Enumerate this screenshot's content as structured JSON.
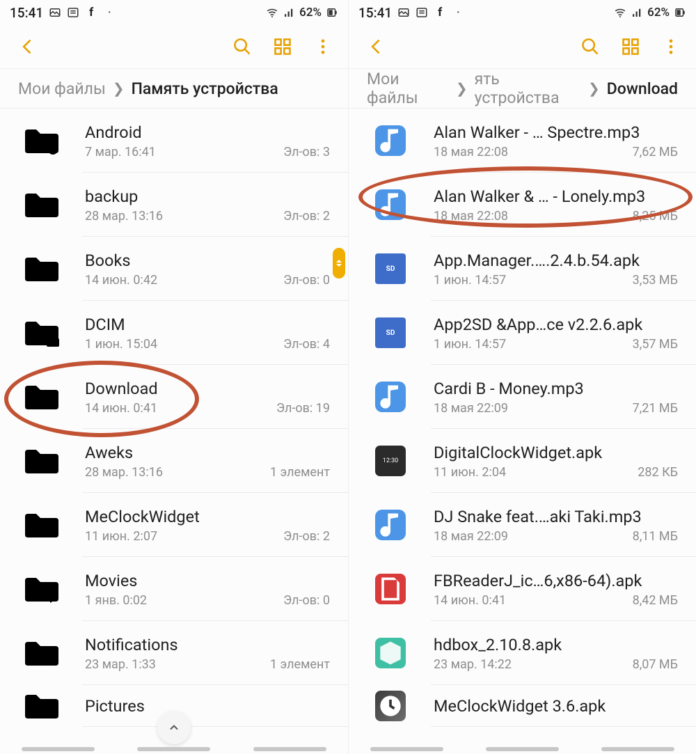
{
  "status": {
    "time": "15:41",
    "battery_pct": "62%"
  },
  "toolbar": {
    "back_label": "back",
    "search_label": "search",
    "grid_label": "grid-view",
    "more_label": "more"
  },
  "left": {
    "breadcrumb": {
      "root": "Мои файлы",
      "current": "Память устройства"
    },
    "rows": [
      {
        "type": "folder-gear",
        "name": "Android",
        "date": "7 мар. 16:41",
        "info": "Эл-ов: 3"
      },
      {
        "type": "folder",
        "name": "backup",
        "date": "28 мар. 13:16",
        "info": "Эл-ов: 2"
      },
      {
        "type": "folder",
        "name": "Books",
        "date": "14 июн. 0:42",
        "info": "Эл-ов: 0"
      },
      {
        "type": "folder-camera",
        "name": "DCIM",
        "date": "1 июн. 15:04",
        "info": "Эл-ов: 4"
      },
      {
        "type": "folder-down",
        "name": "Download",
        "date": "14 июн. 0:41",
        "info": "Эл-ов: 19"
      },
      {
        "type": "folder",
        "name": "Aweks",
        "date": "28 мар. 13:16",
        "info": "1 элемент"
      },
      {
        "type": "folder",
        "name": "MeClockWidget",
        "date": "11 июн. 2:07",
        "info": "Эл-ов: 2"
      },
      {
        "type": "folder-play",
        "name": "Movies",
        "date": "1 янв. 0:02",
        "info": "Эл-ов: 0"
      },
      {
        "type": "folder",
        "name": "Notifications",
        "date": "23 мар. 1:33",
        "info": "1 элемент"
      },
      {
        "type": "folder",
        "name": "Pictures",
        "date": "",
        "info": ""
      }
    ]
  },
  "right": {
    "breadcrumb": {
      "root": "Мои файлы",
      "mid": "ять устройства",
      "current": "Download"
    },
    "rows": [
      {
        "icon": "music",
        "name": "Alan Walker - … Spectre.mp3",
        "date": "18 мая 22:08",
        "info": "7,62 МБ"
      },
      {
        "icon": "music",
        "name": "Alan Walker & … - Lonely.mp3",
        "date": "18 мая 22:08",
        "info": "8,25 МБ"
      },
      {
        "icon": "apk-sd",
        "name": "App.Manager.….2.4.b.54.apk",
        "date": "1 июн. 14:57",
        "info": "3,53 МБ"
      },
      {
        "icon": "apk-sd",
        "name": "App2SD &App…ce v2.2.6.apk",
        "date": "1 июн. 14:57",
        "info": "3,57 МБ"
      },
      {
        "icon": "music",
        "name": "Cardi B - Money.mp3",
        "date": "18 мая 22:09",
        "info": "7,21 МБ"
      },
      {
        "icon": "apk-dark",
        "name": "DigitalClockWidget.apk",
        "date": "11 июн. 2:04",
        "info": "282 КБ"
      },
      {
        "icon": "music",
        "name": "DJ Snake feat.…aki Taki.mp3",
        "date": "18 мая 22:09",
        "info": "8,11 МБ"
      },
      {
        "icon": "apk-red",
        "name": "FBReaderJ_ic…6,x86-64).apk",
        "date": "14 июн. 0:41",
        "info": "8,42 МБ"
      },
      {
        "icon": "apk-teal",
        "name": "hdbox_2.10.8.apk",
        "date": "23 мар. 14:22",
        "info": "8,07 МБ"
      },
      {
        "icon": "apk-clock",
        "name": "MeClockWidget  3.6.apk",
        "date": "",
        "info": ""
      }
    ]
  }
}
